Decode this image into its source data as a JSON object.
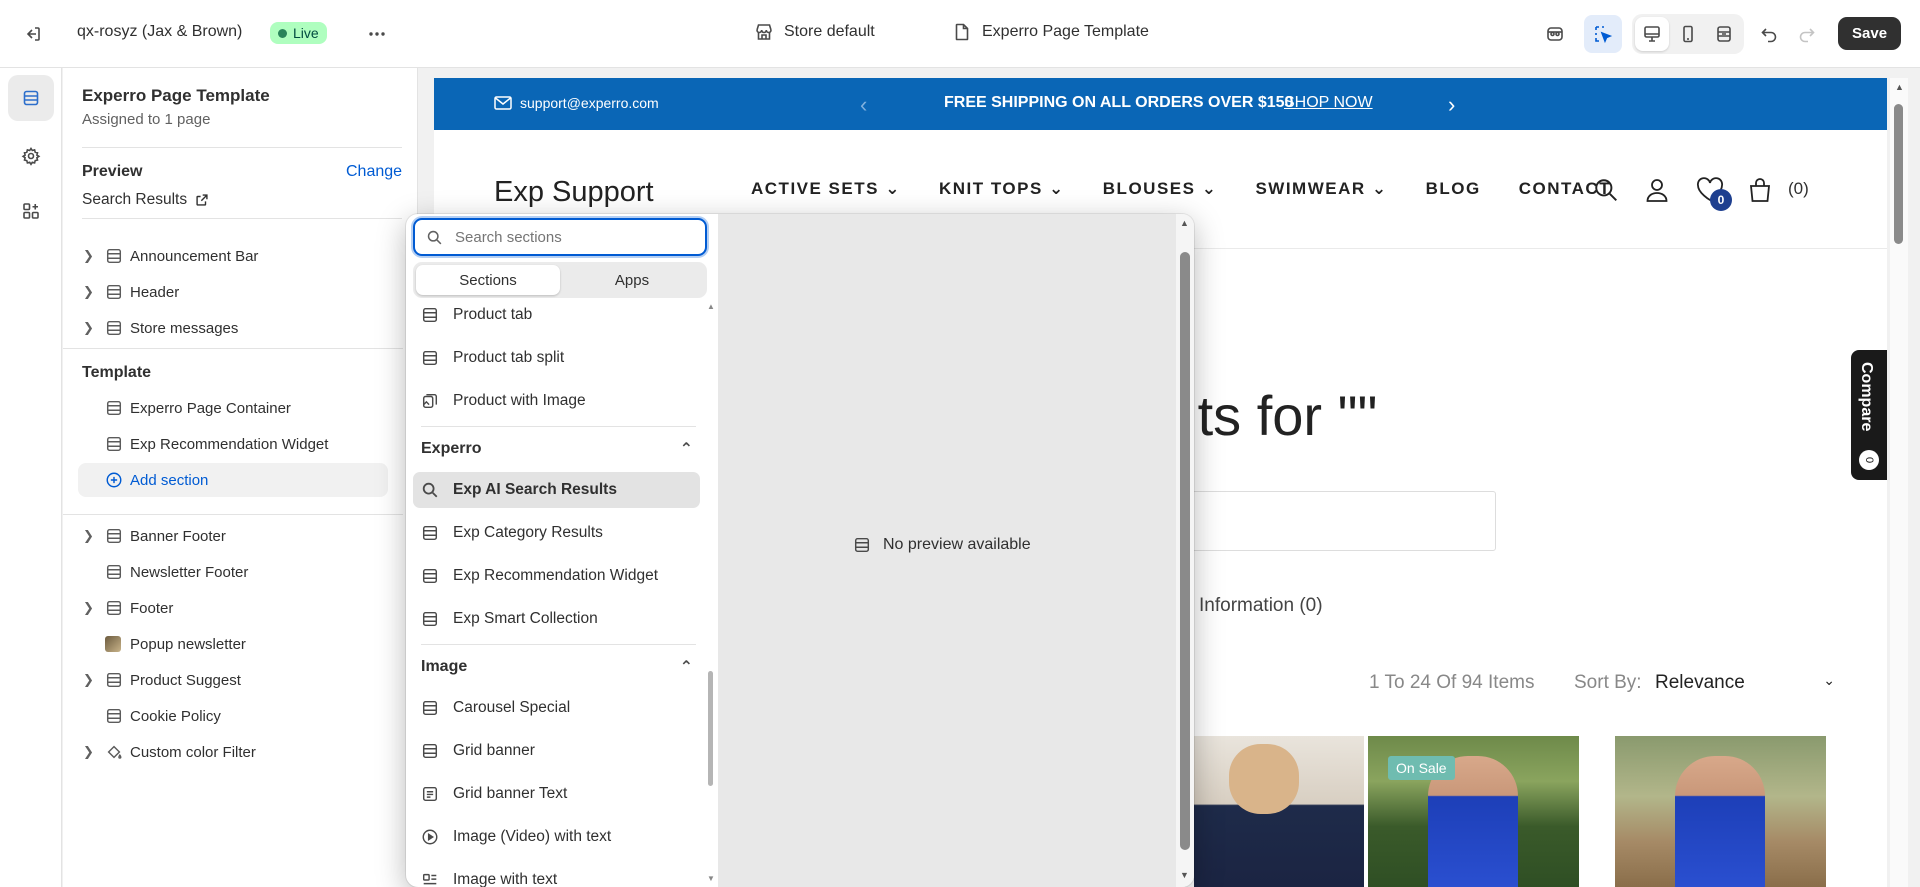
{
  "topbar": {
    "store_name": "qx-rosyz (Jax & Brown)",
    "status": "Live",
    "theme_label": "Store default",
    "template_label": "Experro Page Template",
    "save_label": "Save"
  },
  "sidebar": {
    "title": "Experro Page Template",
    "subtitle": "Assigned to 1 page",
    "preview_heading": "Preview",
    "preview_change": "Change",
    "preview_value": "Search Results",
    "header_items": [
      {
        "label": "Announcement Bar"
      },
      {
        "label": "Header"
      },
      {
        "label": "Store messages"
      }
    ],
    "template_heading": "Template",
    "template_items": [
      {
        "label": "Experro Page Container"
      },
      {
        "label": "Exp Recommendation Widget"
      }
    ],
    "add_section": "Add section",
    "footer_items": [
      {
        "label": "Banner Footer"
      },
      {
        "label": "Newsletter Footer"
      },
      {
        "label": "Footer"
      },
      {
        "label": "Popup newsletter"
      },
      {
        "label": "Product Suggest"
      },
      {
        "label": "Cookie Policy"
      },
      {
        "label": "Custom color Filter"
      }
    ]
  },
  "picker": {
    "search_placeholder": "Search sections",
    "tabs": [
      "Sections",
      "Apps"
    ],
    "top_items": [
      {
        "label": "Product tab",
        "icon": "section-icon"
      },
      {
        "label": "Product tab split",
        "icon": "section-icon"
      },
      {
        "label": "Product with Image",
        "icon": "image-section-icon"
      }
    ],
    "groups": [
      {
        "name": "Experro",
        "items": [
          {
            "label": "Exp AI Search Results",
            "icon": "search-icon",
            "selected": true
          },
          {
            "label": "Exp Category Results",
            "icon": "section-icon"
          },
          {
            "label": "Exp Recommendation Widget",
            "icon": "section-icon"
          },
          {
            "label": "Exp Smart Collection",
            "icon": "section-icon"
          }
        ]
      },
      {
        "name": "Image",
        "items": [
          {
            "label": "Carousel Special",
            "icon": "section-icon"
          },
          {
            "label": "Grid banner",
            "icon": "section-icon"
          },
          {
            "label": "Grid banner Text",
            "icon": "text-section-icon"
          },
          {
            "label": "Image (Video) with text",
            "icon": "play-icon"
          },
          {
            "label": "Image with text",
            "icon": "image-text-icon"
          }
        ]
      }
    ],
    "no_preview": "No preview available"
  },
  "store": {
    "email": "support@experro.com",
    "announcement": "FREE SHIPPING ON ALL ORDERS OVER $150",
    "announcement_link": "SHOP NOW",
    "logo": "Exp Support",
    "nav": [
      "ACTIVE SETS",
      "KNIT TOPS",
      "BLOUSES",
      "SWIMWEAR",
      "BLOG",
      "CONTACT"
    ],
    "wishlist_count": "0",
    "cart_count": "(0)",
    "results_heading": "ults for \"\"",
    "info_tab": "Information (0)",
    "item_count": "1 To 24 Of 94 Items",
    "sort_label": "Sort By:",
    "sort_value": "Relevance",
    "sale_badge": "On Sale",
    "compare_label": "Compare",
    "compare_count": "0"
  },
  "colors": {
    "accent": "#005bd3",
    "announcement_bg": "#0a66b6",
    "live_bg": "#affebf",
    "save_bg": "#303030",
    "wishlist_badge": "#1e3f8f"
  }
}
